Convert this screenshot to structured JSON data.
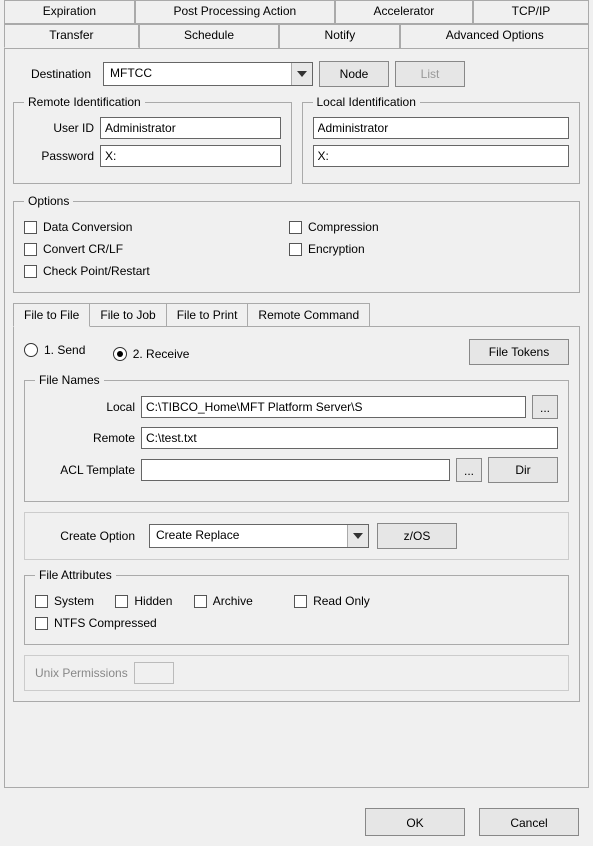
{
  "tabs_row1": [
    "Expiration",
    "Post Processing Action",
    "Accelerator",
    "TCP/IP"
  ],
  "tabs_row2": [
    "Transfer",
    "Schedule",
    "Notify",
    "Advanced Options"
  ],
  "active_tab": "Transfer",
  "destination": {
    "label": "Destination",
    "value": "MFTCC",
    "node_btn": "Node",
    "list_btn": "List"
  },
  "remote_id": {
    "legend": "Remote Identification",
    "user_lbl": "User ID",
    "user_val": "Administrator",
    "pass_lbl": "Password",
    "pass_val": "X:"
  },
  "local_id": {
    "legend": "Local Identification",
    "user_val": "Administrator",
    "pass_val": "X:"
  },
  "options": {
    "legend": "Options",
    "data_conversion": "Data Conversion",
    "convert_crlf": "Convert CR/LF",
    "checkpoint": "Check Point/Restart",
    "compression": "Compression",
    "encryption": "Encryption"
  },
  "subtabs": [
    "File to File",
    "File to Job",
    "File to Print",
    "Remote Command"
  ],
  "active_subtab": "File to File",
  "direction": {
    "send": "1. Send",
    "receive": "2. Receive",
    "selected": "receive",
    "file_tokens_btn": "File Tokens"
  },
  "file_names": {
    "legend": "File Names",
    "local_lbl": "Local",
    "local_val": "C:\\TIBCO_Home\\MFT Platform Server\\S",
    "remote_lbl": "Remote",
    "remote_val": "C:\\test.txt",
    "acl_lbl": "ACL Template",
    "acl_val": "",
    "browse_btn": "...",
    "dir_btn": "Dir"
  },
  "create_option": {
    "label": "Create Option",
    "value": "Create Replace",
    "zos_btn": "z/OS"
  },
  "file_attributes": {
    "legend": "File Attributes",
    "system": "System",
    "hidden": "Hidden",
    "archive": "Archive",
    "readonly": "Read Only",
    "ntfs": "NTFS Compressed"
  },
  "unix": {
    "label": "Unix Permissions",
    "value": ""
  },
  "footer": {
    "ok": "OK",
    "cancel": "Cancel"
  }
}
